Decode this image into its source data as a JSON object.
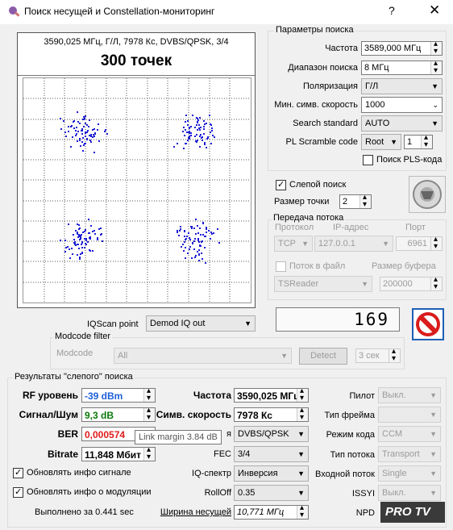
{
  "window": {
    "title": "Поиск несущей и Constellation-мониторинг",
    "help": "?",
    "close": "✕"
  },
  "plot": {
    "caption": "3590,025 МГц, Г/Л, 7978 Кс, DVBS/QPSK, 3/4",
    "points_label": "300 точек"
  },
  "search_params": {
    "group": "Параметры поиска",
    "freq_label": "Частота",
    "freq_value": "3589,000 МГц",
    "range_label": "Диапазон поиска",
    "range_value": "8 МГц",
    "pol_label": "Поляризация",
    "pol_value": "Г/Л",
    "minsr_label": "Мин. симв. скорость",
    "minsr_value": "1000",
    "std_label": "Search standard",
    "std_value": "AUTO",
    "pls_label": "PL Scramble code",
    "pls_type": "Root",
    "pls_value": "1",
    "pls_search_label": "Поиск PLS-кода"
  },
  "blind": {
    "label": "Слепой поиск",
    "dot_size_label": "Размер точки",
    "dot_size_value": "2"
  },
  "stream": {
    "group": "Передача потока",
    "proto_label": "Протокол",
    "ip_label": "IP-адрес",
    "port_label": "Порт",
    "proto_value": "TCP",
    "ip_value": "127.0.0.1",
    "port_value": "6961",
    "tofile_label": "Поток в файл",
    "buffer_label": "Размер буфера",
    "reader_value": "TSReader",
    "buffer_value": "200000"
  },
  "counter": "169",
  "iqscan": {
    "label": "IQScan point",
    "value": "Demod IQ out"
  },
  "modcode": {
    "group": "Modcode filter",
    "label": "Modcode",
    "value": "All",
    "detect": "Detect",
    "sec": "3 сек"
  },
  "results": {
    "group": "Результаты \"слепого\" поиска",
    "rf_label": "RF уровень",
    "rf_value": "-39 dBm",
    "snr_label": "Сигнал/Шум",
    "snr_value": "9,3 dB",
    "ber_label": "BER",
    "ber_value": "0,000574",
    "bitrate_label": "Bitrate",
    "bitrate_value": "11,848 Мбит",
    "freq_label": "Частота",
    "freq_value": "3590,025 МГц",
    "sr_label": "Симв. скорость",
    "sr_value": "7978 Кс",
    "std_label": "я",
    "std_value": "DVBS/QPSK",
    "fec_label": "FEC",
    "fec_value": "3/4",
    "iq_label": "IQ-спектр",
    "iq_value": "Инверсия",
    "rolloff_label": "RollOff",
    "rolloff_value": "0.35",
    "bw_label": "Ширина несущей",
    "bw_value": "10,771 МГц",
    "pilot_label": "Пилот",
    "pilot_value": "Выкл.",
    "frame_label": "Тип фрейма",
    "frame_value": "",
    "coding_label": "Режим кода",
    "coding_value": "CCM",
    "stype_label": "Тип потока",
    "stype_value": "Transport",
    "input_label": "Входной поток",
    "input_value": "Single",
    "issyi_label": "ISSYI",
    "issyi_value": "Выкл.",
    "npd_label": "NPD",
    "upd_signal_label": "Обновлять инфо сигнале",
    "upd_mod_label": "Обновлять инфо о модуляции",
    "done_label": "Выполнено за 0.441 sec",
    "tooltip": "Link margin 3.84 dB"
  },
  "watermark": "PRO TV"
}
